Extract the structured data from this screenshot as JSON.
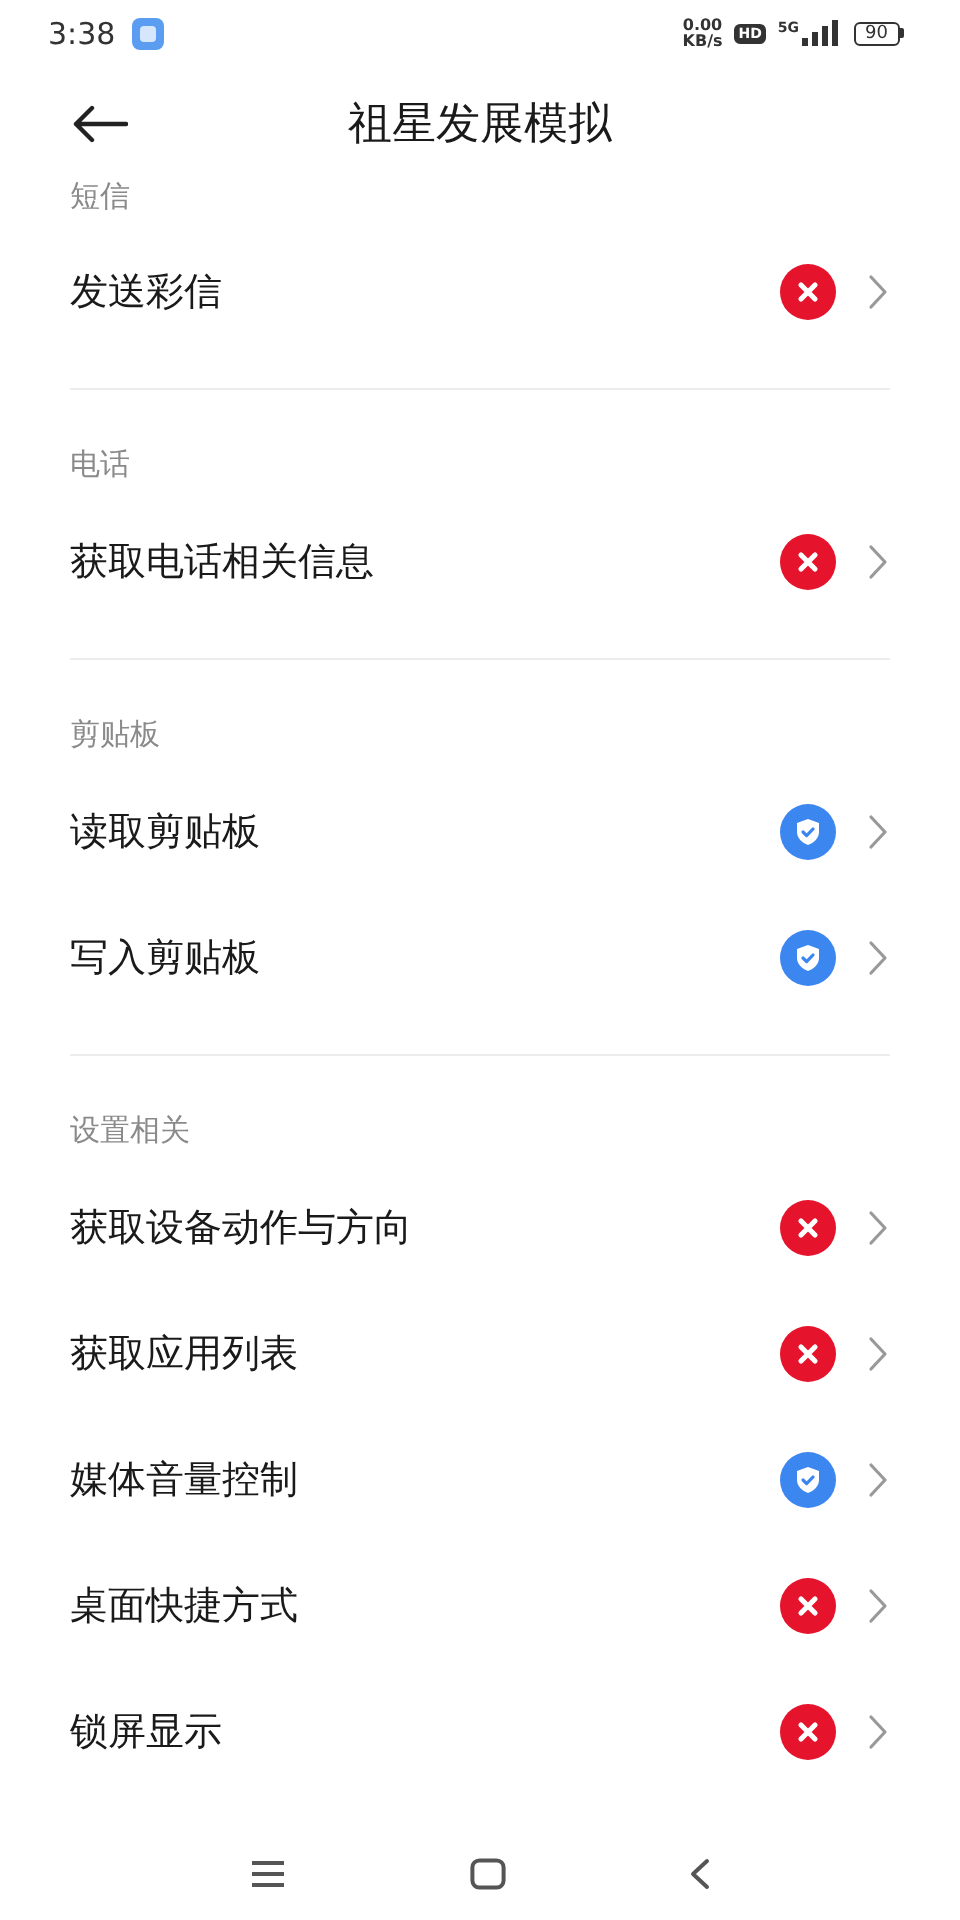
{
  "status_bar": {
    "time": "3:38",
    "net_speed": "0.00",
    "net_unit": "KB/s",
    "hd": "HD",
    "network": "5G",
    "battery": "90"
  },
  "header": {
    "title": "祖星发展模拟"
  },
  "sections": [
    {
      "title": "短信",
      "items": [
        {
          "label": "发送彩信",
          "granted": false
        }
      ]
    },
    {
      "title": "电话",
      "items": [
        {
          "label": "获取电话相关信息",
          "granted": false
        }
      ]
    },
    {
      "title": "剪贴板",
      "items": [
        {
          "label": "读取剪贴板",
          "granted": true
        },
        {
          "label": "写入剪贴板",
          "granted": true
        }
      ]
    },
    {
      "title": "设置相关",
      "items": [
        {
          "label": "获取设备动作与方向",
          "granted": false
        },
        {
          "label": "获取应用列表",
          "granted": false
        },
        {
          "label": "媒体音量控制",
          "granted": true
        },
        {
          "label": "桌面快捷方式",
          "granted": false
        },
        {
          "label": "锁屏显示",
          "granted": false
        }
      ]
    }
  ]
}
